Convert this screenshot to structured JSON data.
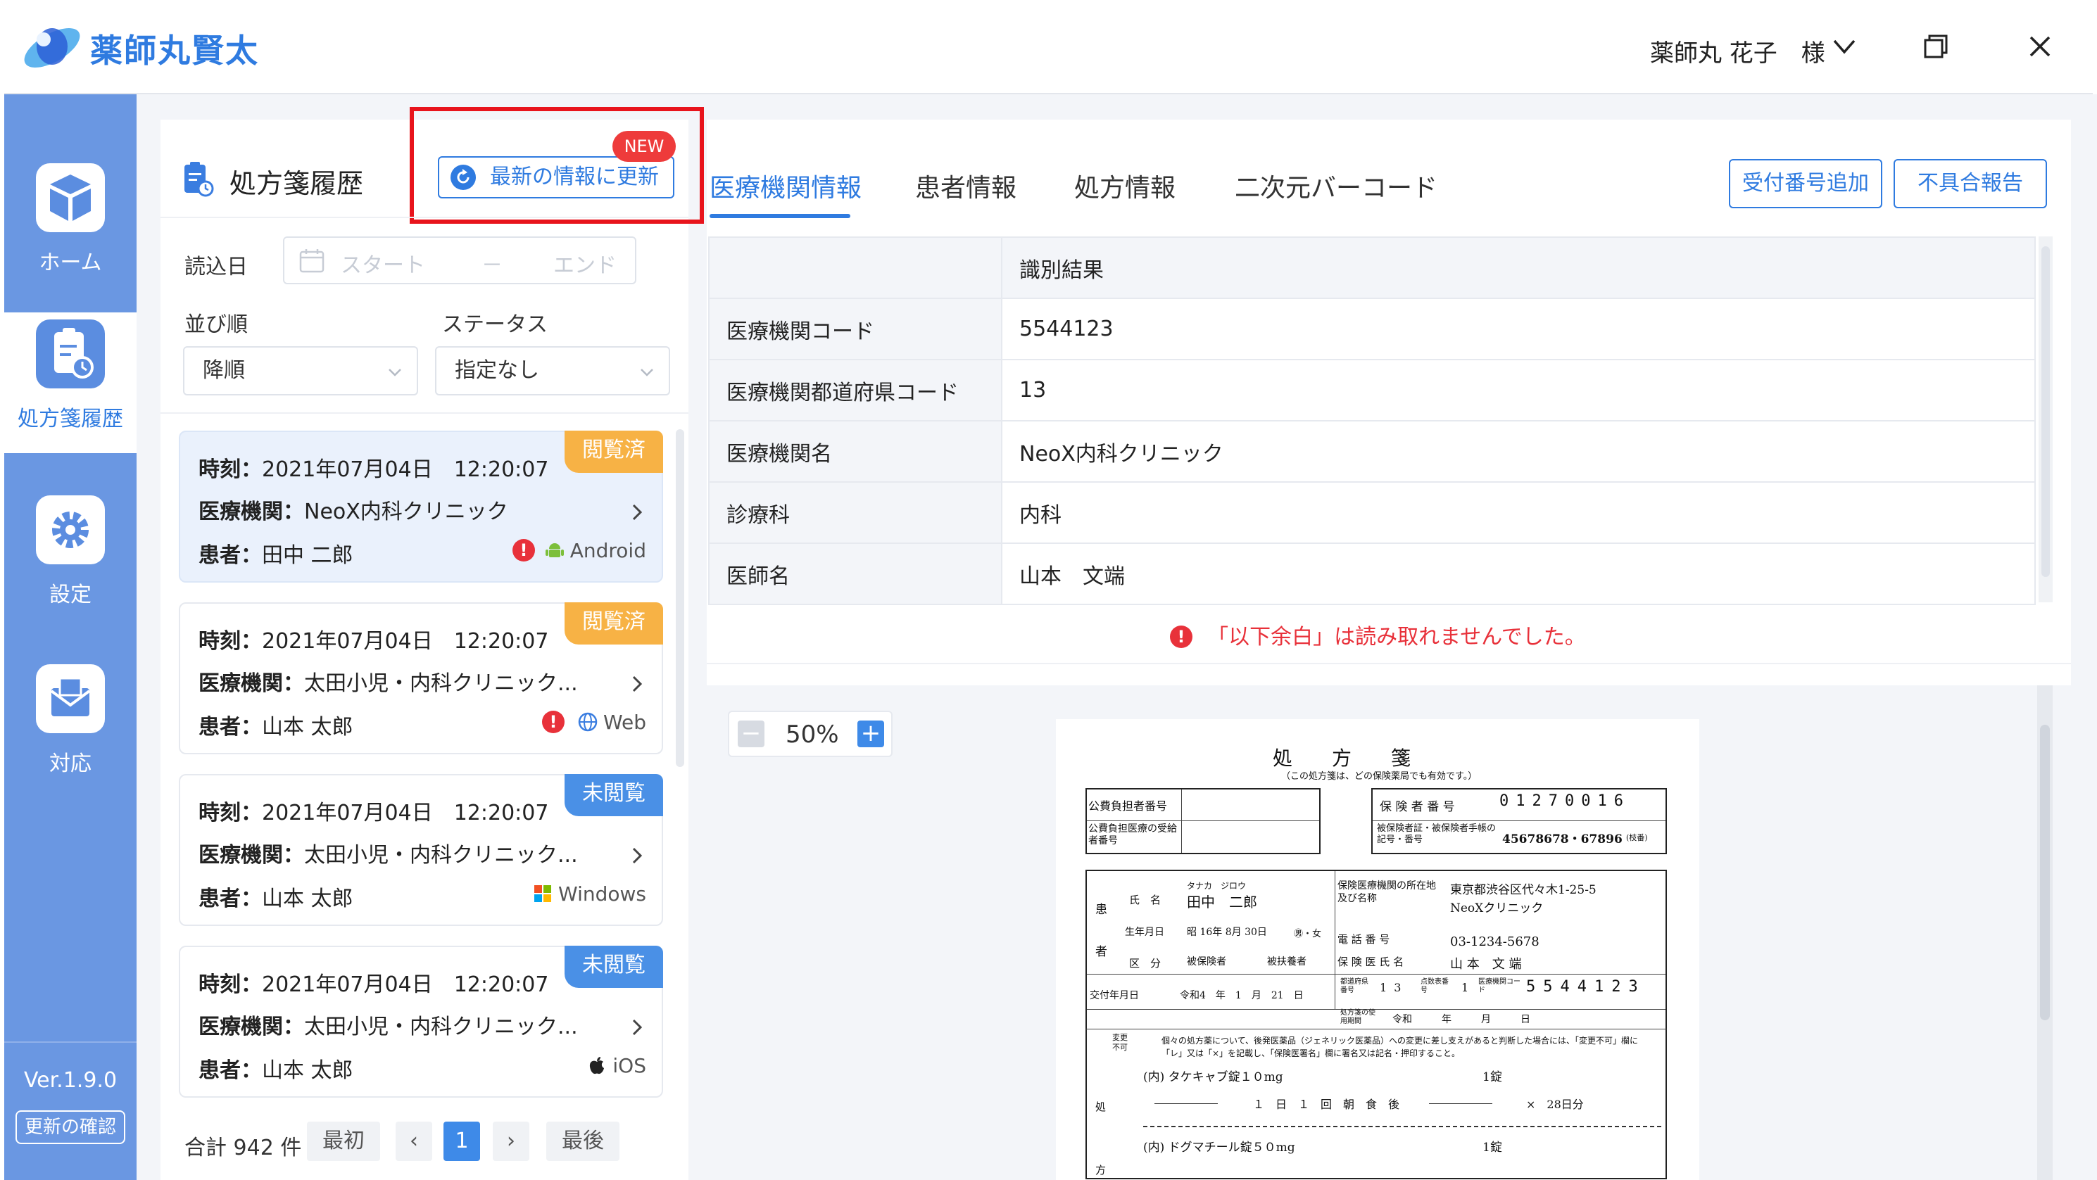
{
  "app": {
    "title": "薬師丸賢太",
    "user": "薬師丸 花子　様"
  },
  "sidebar": {
    "items": [
      {
        "label": "ホーム",
        "icon": "cube-icon"
      },
      {
        "label": "処方箋履歴",
        "icon": "prescription-history-icon"
      },
      {
        "label": "設定",
        "icon": "gear-icon"
      },
      {
        "label": "対応",
        "icon": "mail-icon"
      }
    ],
    "version": "Ver.1.9.0",
    "update_check": "更新の確認"
  },
  "history": {
    "title": "処方箋履歴",
    "refresh_label": "最新の情報に更新",
    "new_badge": "NEW",
    "read_date_label": "読込日",
    "date_start_placeholder": "スタート",
    "date_sep": "－",
    "date_end_placeholder": "エンド",
    "sort_label": "並び順",
    "status_label": "ステータス",
    "sort_value": "降順",
    "status_value": "指定なし",
    "cards": [
      {
        "badge": "閲覧済",
        "time_label": "時刻：",
        "time": "2021年07月04日　12:20:07",
        "clinic_label": "医療機関：",
        "clinic": "NeoX内科クリニック",
        "patient_label": "患者：",
        "patient": "田中 二郎",
        "warning": "!",
        "platform": "Android"
      },
      {
        "badge": "閲覧済",
        "time_label": "時刻：",
        "time": "2021年07月04日　12:20:07",
        "clinic_label": "医療機関：",
        "clinic": "太田小児・内科クリニック...",
        "patient_label": "患者：",
        "patient": "山本 太郎",
        "warning": "!",
        "platform": "Web"
      },
      {
        "badge": "未閲覧",
        "time_label": "時刻：",
        "time": "2021年07月04日　12:20:07",
        "clinic_label": "医療機関：",
        "clinic": "太田小児・内科クリニック...",
        "patient_label": "患者：",
        "patient": "山本 太郎",
        "platform": "Windows"
      },
      {
        "badge": "未閲覧",
        "time_label": "時刻：",
        "time": "2021年07月04日　12:20:07",
        "clinic_label": "医療機関：",
        "clinic": "太田小児・内科クリニック...",
        "patient_label": "患者：",
        "patient": "山本 太郎",
        "platform": "iOS"
      }
    ],
    "pagination": {
      "total": "合計 942 件",
      "first": "最初",
      "prev": "‹",
      "current": "1",
      "next": "›",
      "last": "最後"
    }
  },
  "detail": {
    "tabs": [
      "医療機関情報",
      "患者情報",
      "処方情報",
      "二次元バーコード"
    ],
    "buttons": {
      "add_reception": "受付番号追加",
      "report_issue": "不具合報告"
    },
    "table_header": "識別結果",
    "rows": [
      {
        "key": "医療機関コード",
        "value": "5544123"
      },
      {
        "key": "医療機関都道府県コード",
        "value": "13"
      },
      {
        "key": "医療機関名",
        "value": "NeoX内科クリニック"
      },
      {
        "key": "診療科",
        "value": "内科"
      },
      {
        "key": "医師名",
        "value": "山本　文端"
      }
    ],
    "warning": "「以下余白」は読み取れませんでした。",
    "zoom": "50%"
  },
  "doc": {
    "title": "処　　方　　箋",
    "subtitle": "（この処方箋は、どの保険薬局でも有効です。）",
    "payer_no_label": "公費負担者番号",
    "payer_recipient_label": "公費負担医療の受給者番号",
    "insurer_no_label": "保 険 者 番 号",
    "insurer_digits": [
      "0",
      "1",
      "2",
      "7",
      "0",
      "0",
      "1",
      "6"
    ],
    "insured_id_label": "被保険者証・被保険者手帳の記号・番号",
    "insured_id": "45678678・67896",
    "insured_id_suffix": "(枝番)",
    "patient_label": "患",
    "patient_label2": "者",
    "name_label": "氏　名",
    "name_kana": "タナカ　ジロウ",
    "name": "田中　二郎",
    "dob_label": "生年月日",
    "dob": "昭 16年 8月 30日",
    "sex": "㊚・女",
    "category_label": "区　分",
    "category_insured": "被保険者",
    "category_dependent": "被扶養者",
    "clinic_addr_label": "保険医療機関の所在地及び名称",
    "clinic_addr": "東京都渋谷区代々木1-25-5",
    "clinic_name": "NeoXクリニック",
    "phone_label": "電 話 番 号",
    "phone": "03-1234-5678",
    "doctor_label": "保 険 医 氏 名",
    "doctor": "山 本　文 端",
    "pref_label": "都道府県番号",
    "pref_digits": [
      "1",
      "3"
    ],
    "score_label": "点数表番号",
    "score_digit": "1",
    "inst_code_label": "医療機関コード",
    "inst_digits": [
      "5",
      "5",
      "4",
      "4",
      "1",
      "2",
      "3"
    ],
    "issue_label": "交付年月日",
    "issue_date": "令和4　年　1　月　21　日",
    "expiry_label": "処方箋の使用期間",
    "expiry": "令和　　　年　　　月　　　日",
    "change_label": "変更不可",
    "notice": "個々の処方薬について、後発医薬品（ジェネリック医薬品）への変更に差し支えがあると判断した場合には、「変更不可」欄に「レ」又は「×」を記載し、「保険医署名」欄に署名又は記名・押印すること。",
    "rx_label": "処",
    "rx_label2": "方",
    "rx1": "(内) タケキャブ錠１０mg",
    "rx1_qty": "1錠",
    "rx1_dose": "１　日　１　回　朝　食　後",
    "rx1_days": "×　28日分",
    "rx2": "(内) ドグマチール錠５０mg",
    "rx2_qty": "1錠"
  }
}
